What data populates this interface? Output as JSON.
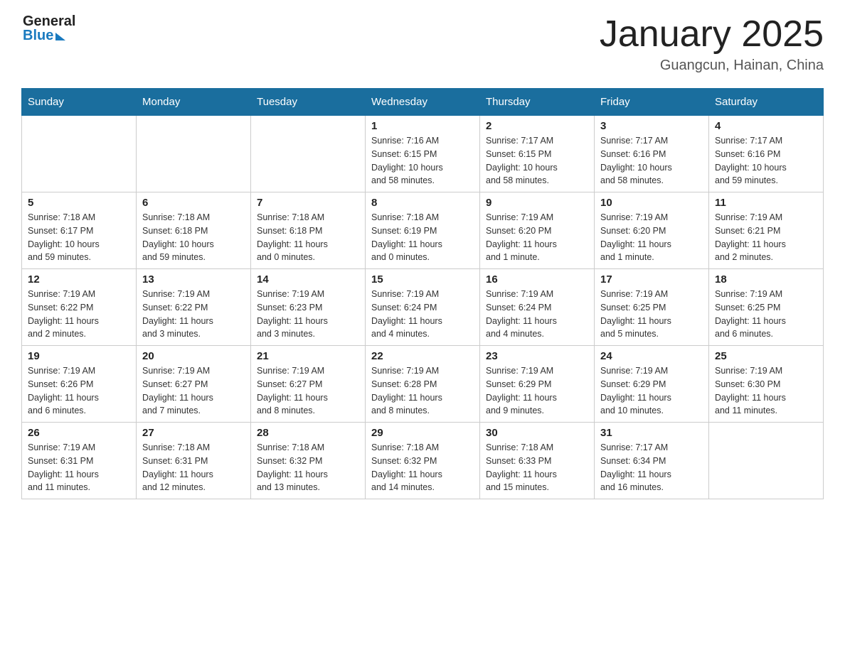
{
  "header": {
    "logo_general": "General",
    "logo_blue": "Blue",
    "month_title": "January 2025",
    "location": "Guangcun, Hainan, China"
  },
  "days_of_week": [
    "Sunday",
    "Monday",
    "Tuesday",
    "Wednesday",
    "Thursday",
    "Friday",
    "Saturday"
  ],
  "weeks": [
    [
      {
        "day": "",
        "info": ""
      },
      {
        "day": "",
        "info": ""
      },
      {
        "day": "",
        "info": ""
      },
      {
        "day": "1",
        "info": "Sunrise: 7:16 AM\nSunset: 6:15 PM\nDaylight: 10 hours\nand 58 minutes."
      },
      {
        "day": "2",
        "info": "Sunrise: 7:17 AM\nSunset: 6:15 PM\nDaylight: 10 hours\nand 58 minutes."
      },
      {
        "day": "3",
        "info": "Sunrise: 7:17 AM\nSunset: 6:16 PM\nDaylight: 10 hours\nand 58 minutes."
      },
      {
        "day": "4",
        "info": "Sunrise: 7:17 AM\nSunset: 6:16 PM\nDaylight: 10 hours\nand 59 minutes."
      }
    ],
    [
      {
        "day": "5",
        "info": "Sunrise: 7:18 AM\nSunset: 6:17 PM\nDaylight: 10 hours\nand 59 minutes."
      },
      {
        "day": "6",
        "info": "Sunrise: 7:18 AM\nSunset: 6:18 PM\nDaylight: 10 hours\nand 59 minutes."
      },
      {
        "day": "7",
        "info": "Sunrise: 7:18 AM\nSunset: 6:18 PM\nDaylight: 11 hours\nand 0 minutes."
      },
      {
        "day": "8",
        "info": "Sunrise: 7:18 AM\nSunset: 6:19 PM\nDaylight: 11 hours\nand 0 minutes."
      },
      {
        "day": "9",
        "info": "Sunrise: 7:19 AM\nSunset: 6:20 PM\nDaylight: 11 hours\nand 1 minute."
      },
      {
        "day": "10",
        "info": "Sunrise: 7:19 AM\nSunset: 6:20 PM\nDaylight: 11 hours\nand 1 minute."
      },
      {
        "day": "11",
        "info": "Sunrise: 7:19 AM\nSunset: 6:21 PM\nDaylight: 11 hours\nand 2 minutes."
      }
    ],
    [
      {
        "day": "12",
        "info": "Sunrise: 7:19 AM\nSunset: 6:22 PM\nDaylight: 11 hours\nand 2 minutes."
      },
      {
        "day": "13",
        "info": "Sunrise: 7:19 AM\nSunset: 6:22 PM\nDaylight: 11 hours\nand 3 minutes."
      },
      {
        "day": "14",
        "info": "Sunrise: 7:19 AM\nSunset: 6:23 PM\nDaylight: 11 hours\nand 3 minutes."
      },
      {
        "day": "15",
        "info": "Sunrise: 7:19 AM\nSunset: 6:24 PM\nDaylight: 11 hours\nand 4 minutes."
      },
      {
        "day": "16",
        "info": "Sunrise: 7:19 AM\nSunset: 6:24 PM\nDaylight: 11 hours\nand 4 minutes."
      },
      {
        "day": "17",
        "info": "Sunrise: 7:19 AM\nSunset: 6:25 PM\nDaylight: 11 hours\nand 5 minutes."
      },
      {
        "day": "18",
        "info": "Sunrise: 7:19 AM\nSunset: 6:25 PM\nDaylight: 11 hours\nand 6 minutes."
      }
    ],
    [
      {
        "day": "19",
        "info": "Sunrise: 7:19 AM\nSunset: 6:26 PM\nDaylight: 11 hours\nand 6 minutes."
      },
      {
        "day": "20",
        "info": "Sunrise: 7:19 AM\nSunset: 6:27 PM\nDaylight: 11 hours\nand 7 minutes."
      },
      {
        "day": "21",
        "info": "Sunrise: 7:19 AM\nSunset: 6:27 PM\nDaylight: 11 hours\nand 8 minutes."
      },
      {
        "day": "22",
        "info": "Sunrise: 7:19 AM\nSunset: 6:28 PM\nDaylight: 11 hours\nand 8 minutes."
      },
      {
        "day": "23",
        "info": "Sunrise: 7:19 AM\nSunset: 6:29 PM\nDaylight: 11 hours\nand 9 minutes."
      },
      {
        "day": "24",
        "info": "Sunrise: 7:19 AM\nSunset: 6:29 PM\nDaylight: 11 hours\nand 10 minutes."
      },
      {
        "day": "25",
        "info": "Sunrise: 7:19 AM\nSunset: 6:30 PM\nDaylight: 11 hours\nand 11 minutes."
      }
    ],
    [
      {
        "day": "26",
        "info": "Sunrise: 7:19 AM\nSunset: 6:31 PM\nDaylight: 11 hours\nand 11 minutes."
      },
      {
        "day": "27",
        "info": "Sunrise: 7:18 AM\nSunset: 6:31 PM\nDaylight: 11 hours\nand 12 minutes."
      },
      {
        "day": "28",
        "info": "Sunrise: 7:18 AM\nSunset: 6:32 PM\nDaylight: 11 hours\nand 13 minutes."
      },
      {
        "day": "29",
        "info": "Sunrise: 7:18 AM\nSunset: 6:32 PM\nDaylight: 11 hours\nand 14 minutes."
      },
      {
        "day": "30",
        "info": "Sunrise: 7:18 AM\nSunset: 6:33 PM\nDaylight: 11 hours\nand 15 minutes."
      },
      {
        "day": "31",
        "info": "Sunrise: 7:17 AM\nSunset: 6:34 PM\nDaylight: 11 hours\nand 16 minutes."
      },
      {
        "day": "",
        "info": ""
      }
    ]
  ]
}
